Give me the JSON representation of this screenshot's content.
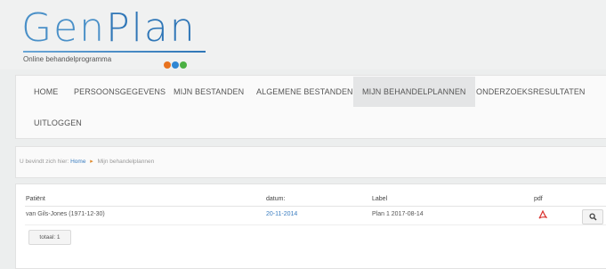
{
  "brand": {
    "name_part1": "Gen",
    "name_part2": "Plan",
    "tagline": "Online behandelprogramma",
    "dot_colors": [
      "#e8731f",
      "#2f86d3",
      "#4bb043"
    ]
  },
  "nav": {
    "items": [
      {
        "label": "HOME",
        "active": false
      },
      {
        "label": "PERSOONSGEGEVENS",
        "active": false
      },
      {
        "label": "MIJN BESTANDEN",
        "active": false
      },
      {
        "label": "ALGEMENE BESTANDEN",
        "active": false
      },
      {
        "label": "MIJN BEHANDELPLANNEN",
        "active": true
      },
      {
        "label": "ONDERZOEKSRESULTATEN",
        "active": false
      },
      {
        "label": "UITLOGGEN",
        "active": false
      }
    ]
  },
  "breadcrumb": {
    "prefix": "U bevindt zich hier:",
    "home": "Home",
    "separator": "▸",
    "current": "Mijn behandelplannen"
  },
  "table": {
    "headers": {
      "patient": "Patiënt",
      "datum": "datum:",
      "label": "Label",
      "pdf": "pdf"
    },
    "rows": [
      {
        "patient": "van Gils-Jones (1971-12-30)",
        "datum": "20-11-2014",
        "label": "Plan 1 2017-08-14",
        "pdf_icon": "pdf-icon",
        "action_icon": "search-icon"
      }
    ],
    "total": "totaal: 1"
  },
  "colors": {
    "accent_blue": "#3a7dc0",
    "pdf_red": "#d9302c",
    "breadcrumb_arrow": "#e08a2c"
  }
}
